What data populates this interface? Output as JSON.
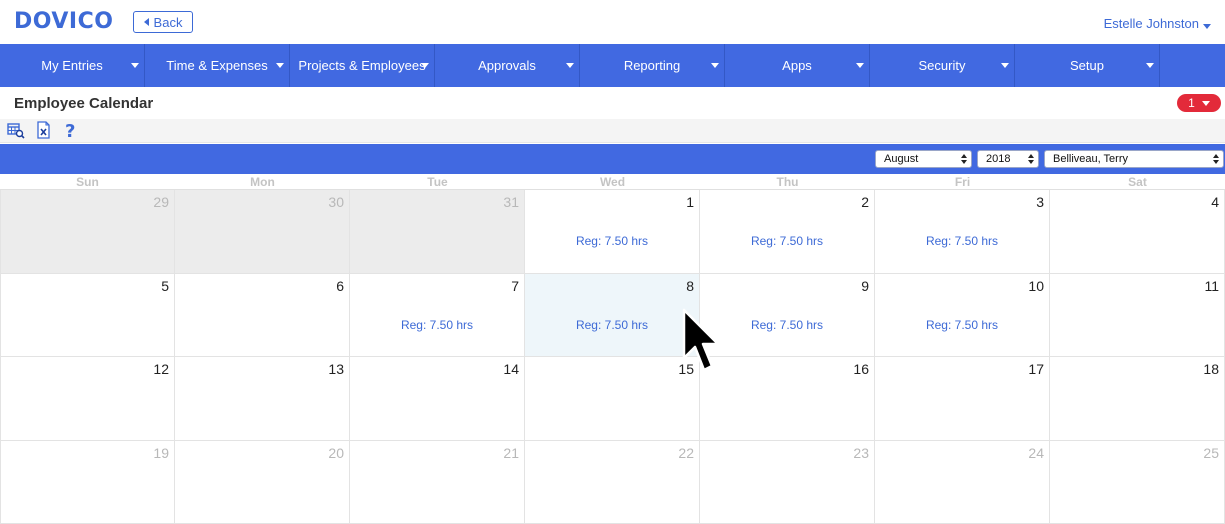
{
  "app": {
    "logo": "DOVICO",
    "back_label": "Back",
    "user_name": "Estelle Johnston"
  },
  "nav": {
    "items": [
      {
        "label": "My Entries"
      },
      {
        "label": "Time & Expenses"
      },
      {
        "label": "Projects & Employees"
      },
      {
        "label": "Approvals"
      },
      {
        "label": "Reporting"
      },
      {
        "label": "Apps"
      },
      {
        "label": "Security"
      },
      {
        "label": "Setup"
      }
    ]
  },
  "page": {
    "title": "Employee Calendar",
    "notification_count": "1"
  },
  "toolbar": {
    "icons": [
      "calendar-search-icon",
      "clear-excel-icon",
      "help-icon"
    ]
  },
  "filters": {
    "month": "August",
    "year": "2018",
    "employee": "Belliveau, Terry"
  },
  "calendar": {
    "days_of_week": [
      "Sun",
      "Mon",
      "Tue",
      "Wed",
      "Thu",
      "Fri",
      "Sat"
    ],
    "weeks": [
      [
        {
          "day": "29",
          "other": true,
          "entry": ""
        },
        {
          "day": "30",
          "other": true,
          "entry": ""
        },
        {
          "day": "31",
          "other": true,
          "entry": ""
        },
        {
          "day": "1",
          "entry": "Reg: 7.50 hrs"
        },
        {
          "day": "2",
          "entry": "Reg: 7.50 hrs"
        },
        {
          "day": "3",
          "entry": "Reg: 7.50 hrs"
        },
        {
          "day": "4",
          "entry": ""
        }
      ],
      [
        {
          "day": "5",
          "entry": ""
        },
        {
          "day": "6",
          "entry": ""
        },
        {
          "day": "7",
          "entry": "Reg: 7.50 hrs"
        },
        {
          "day": "8",
          "entry": "Reg: 7.50 hrs",
          "selected": true
        },
        {
          "day": "9",
          "entry": "Reg: 7.50 hrs"
        },
        {
          "day": "10",
          "entry": "Reg: 7.50 hrs"
        },
        {
          "day": "11",
          "entry": ""
        }
      ],
      [
        {
          "day": "12",
          "entry": ""
        },
        {
          "day": "13",
          "entry": ""
        },
        {
          "day": "14",
          "entry": ""
        },
        {
          "day": "15",
          "entry": ""
        },
        {
          "day": "16",
          "entry": ""
        },
        {
          "day": "17",
          "entry": ""
        },
        {
          "day": "18",
          "entry": ""
        }
      ],
      [
        {
          "day": "19",
          "entry": "",
          "faded": true
        },
        {
          "day": "20",
          "entry": "",
          "faded": true
        },
        {
          "day": "21",
          "entry": "",
          "faded": true
        },
        {
          "day": "22",
          "entry": "",
          "faded": true
        },
        {
          "day": "23",
          "entry": "",
          "faded": true
        },
        {
          "day": "24",
          "entry": "",
          "faded": true
        },
        {
          "day": "25",
          "entry": "",
          "faded": true
        }
      ]
    ]
  },
  "colors": {
    "brand": "#4169e1",
    "link": "#3d6ad6",
    "badge": "#e32a3a"
  }
}
